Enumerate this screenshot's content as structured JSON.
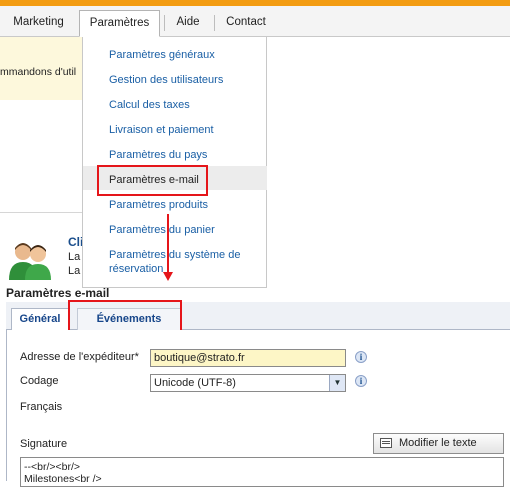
{
  "nav": {
    "tabs": [
      {
        "label": "Marketing"
      },
      {
        "label": "Paramètres",
        "active": true
      },
      {
        "label": "Aide"
      },
      {
        "label": "Contact"
      }
    ]
  },
  "background": {
    "fragment_text": "mmandons d'util",
    "customer_fragment": "Cli",
    "line_fragments": [
      "La",
      "La"
    ]
  },
  "menu": {
    "items": [
      "Paramètres généraux",
      "Gestion des utilisateurs",
      "Calcul des taxes",
      "Livraison et paiement",
      "Paramètres du pays",
      "Paramètres e-mail",
      "Paramètres produits",
      "Paramètres du panier",
      "Paramètres du système de",
      "réservation"
    ],
    "highlighted": "Paramètres e-mail"
  },
  "section": {
    "title": "Paramètres e-mail",
    "tabs": [
      {
        "label": "Général",
        "active": true
      },
      {
        "label": "Événements"
      }
    ]
  },
  "form": {
    "sender_label": "Adresse de l'expéditeur*",
    "sender_value": "boutique@strato.fr",
    "encoding_label": "Codage",
    "encoding_value": "Unicode (UTF-8)",
    "language_label": "Français",
    "signature_label": "Signature",
    "modify_button": "Modifier le texte",
    "signature_lines": [
      "--<br/><br/>",
      "Milestones<br />"
    ]
  },
  "icons": {
    "info": "i",
    "dropdown": "▼"
  },
  "colors": {
    "accent_orange": "#f39c12",
    "annotation_red": "#e5151a",
    "link_blue": "#1a5fa5",
    "input_yellow": "#fdf6c6"
  }
}
